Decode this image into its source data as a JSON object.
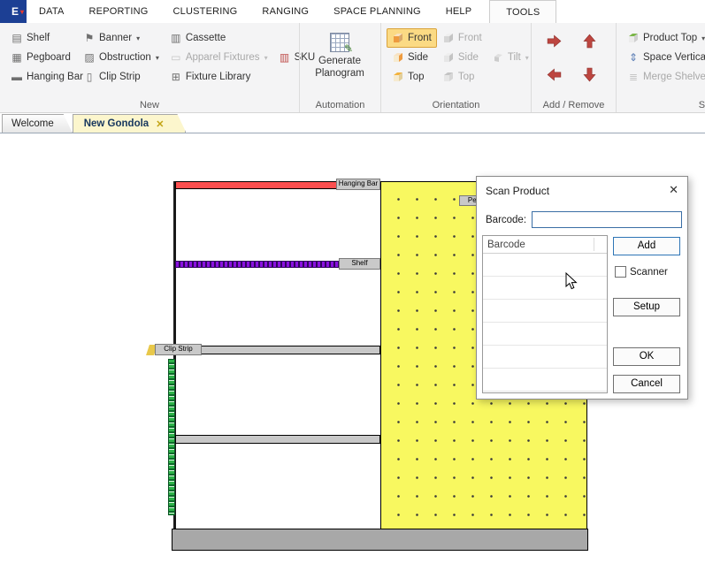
{
  "menubar": {
    "file_label": "E",
    "items": [
      {
        "label": "DATA"
      },
      {
        "label": "REPORTING"
      },
      {
        "label": "CLUSTERING"
      },
      {
        "label": "RANGING"
      },
      {
        "label": "SPACE PLANNING"
      },
      {
        "label": "HELP"
      },
      {
        "label": "TOOLS"
      }
    ]
  },
  "ribbon": {
    "new": {
      "label": "New",
      "shelf": "Shelf",
      "pegboard": "Pegboard",
      "hanging_bar": "Hanging Bar",
      "banner": "Banner",
      "obstruction": "Obstruction",
      "clip_strip": "Clip Strip",
      "cassette": "Cassette",
      "apparel_fixtures": "Apparel Fixtures",
      "sku": "SKU",
      "fixture_library": "Fixture Library"
    },
    "automation": {
      "label": "Automation",
      "generate_planogram": "Generate Planogram"
    },
    "orientation": {
      "label": "Orientation",
      "front_active": "Front",
      "side_active": "Side",
      "top_active": "Top",
      "front_disabled": "Front",
      "side_disabled": "Side",
      "top_disabled": "Top",
      "tilt": "Tilt"
    },
    "add_remove": {
      "label": "Add / Remove"
    },
    "shelves": {
      "label": "Sh",
      "product_top": "Product Top",
      "space_vertically": "Space Vertically",
      "merge_shelves": "Merge Shelves"
    }
  },
  "tabs": {
    "welcome": "Welcome",
    "new_gondola": "New Gondola"
  },
  "canvas": {
    "hanging_bar_label": "Hanging Bar",
    "pegboard_label": "Peg",
    "shelf_label": "Shelf",
    "clip_strip_label": "Clip Strip"
  },
  "dialog": {
    "title": "Scan Product",
    "barcode_label": "Barcode:",
    "barcode_value": "",
    "list_header": "Barcode",
    "add_button": "Add",
    "scanner_label": "Scanner",
    "setup_button": "Setup",
    "ok_button": "OK",
    "cancel_button": "Cancel"
  }
}
